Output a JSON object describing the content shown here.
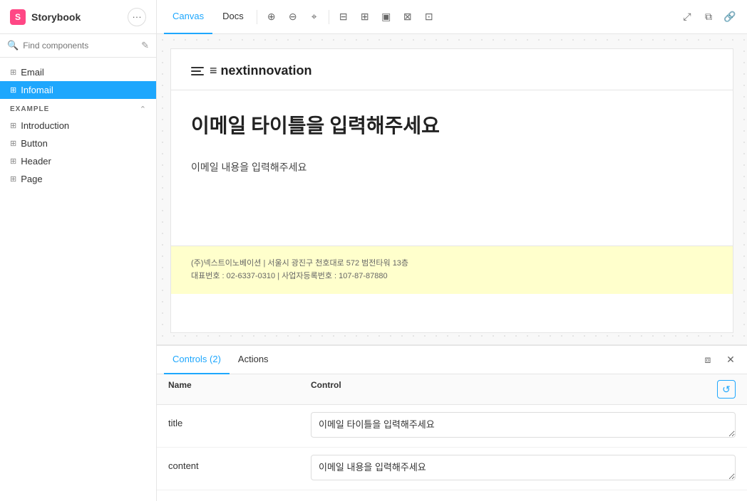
{
  "app": {
    "title": "Storybook"
  },
  "sidebar": {
    "search_placeholder": "Find components",
    "items_top": [
      {
        "id": "email",
        "label": "Email",
        "active": false
      }
    ],
    "items_active": [
      {
        "id": "infomail",
        "label": "Infomail",
        "active": true
      }
    ],
    "section_label": "EXAMPLE",
    "section_items": [
      {
        "id": "introduction",
        "label": "Introduction"
      },
      {
        "id": "button",
        "label": "Button"
      },
      {
        "id": "header",
        "label": "Header"
      },
      {
        "id": "page",
        "label": "Page"
      }
    ]
  },
  "toolbar": {
    "tabs": [
      {
        "id": "canvas",
        "label": "Canvas",
        "active": true
      },
      {
        "id": "docs",
        "label": "Docs",
        "active": false
      }
    ]
  },
  "canvas": {
    "brand": "≡ nextinnovation",
    "email_title": "이메일 타이틀을 입력해주세요",
    "email_content": "이메일 내용을 입력해주세요",
    "footer_line1": "(주)넥스트이노베이션 | 서울시 광진구 천호대로 572 범전타워 13층",
    "footer_line2": "대표번호 : 02-6337-0310 | 사업자등록번호 : 107-87-87880"
  },
  "bottom_panel": {
    "tabs": [
      {
        "id": "controls",
        "label": "Controls (2)",
        "active": true
      },
      {
        "id": "actions",
        "label": "Actions",
        "active": false
      }
    ],
    "controls_col_name": "Name",
    "controls_col_control": "Control",
    "rows": [
      {
        "name": "title",
        "value": "이메일 타이틀을 입력해주세요"
      },
      {
        "name": "content",
        "value": "이메일 내용을 입력해주세요"
      }
    ]
  }
}
